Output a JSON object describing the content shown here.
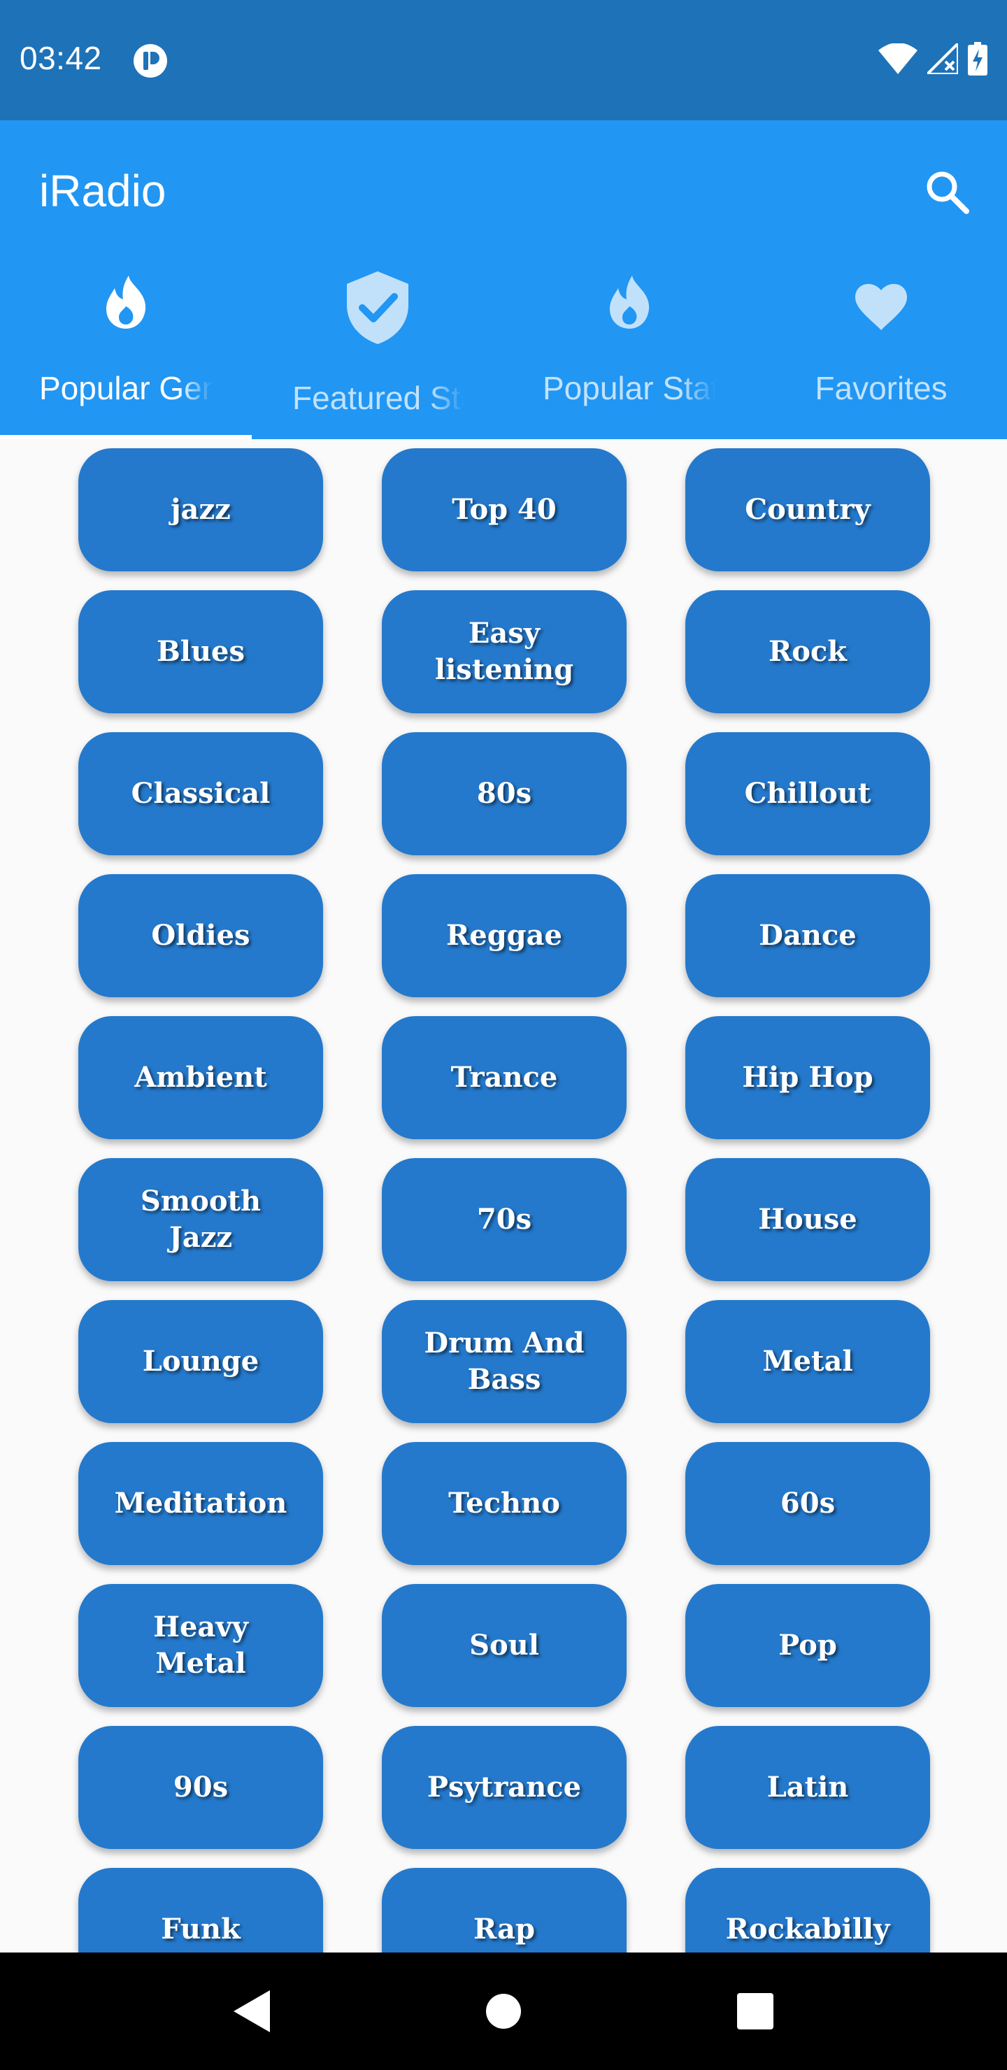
{
  "status_bar": {
    "time": "03:42"
  },
  "app_bar": {
    "title": "iRadio"
  },
  "tabs": [
    {
      "label": "Popular Genres",
      "icon": "flame-icon",
      "active": true
    },
    {
      "label": "Featured Stations",
      "icon": "verified-shield-icon",
      "active": false
    },
    {
      "label": "Popular Stations",
      "icon": "flame-icon",
      "active": false
    },
    {
      "label": "Favorites",
      "icon": "heart-icon",
      "active": false
    }
  ],
  "genres": [
    "jazz",
    "Top 40",
    "Country",
    "Blues",
    "Easy listening",
    "Rock",
    "Classical",
    "80s",
    "Chillout",
    "Oldies",
    "Reggae",
    "Dance",
    "Ambient",
    "Trance",
    "Hip Hop",
    "Smooth Jazz",
    "70s",
    "House",
    "Lounge",
    "Drum And Bass",
    "Metal",
    "Meditation",
    "Techno",
    "60s",
    "Heavy Metal",
    "Soul",
    "Pop",
    "90s",
    "Psytrance",
    "Latin",
    "Funk",
    "Rap",
    "Rockabilly"
  ],
  "colors": {
    "status_bar": "#1e72b8",
    "app_bar": "#2196f3",
    "genre_button": "#2479cc",
    "background": "#fafafa",
    "nav_bar": "#000000"
  }
}
